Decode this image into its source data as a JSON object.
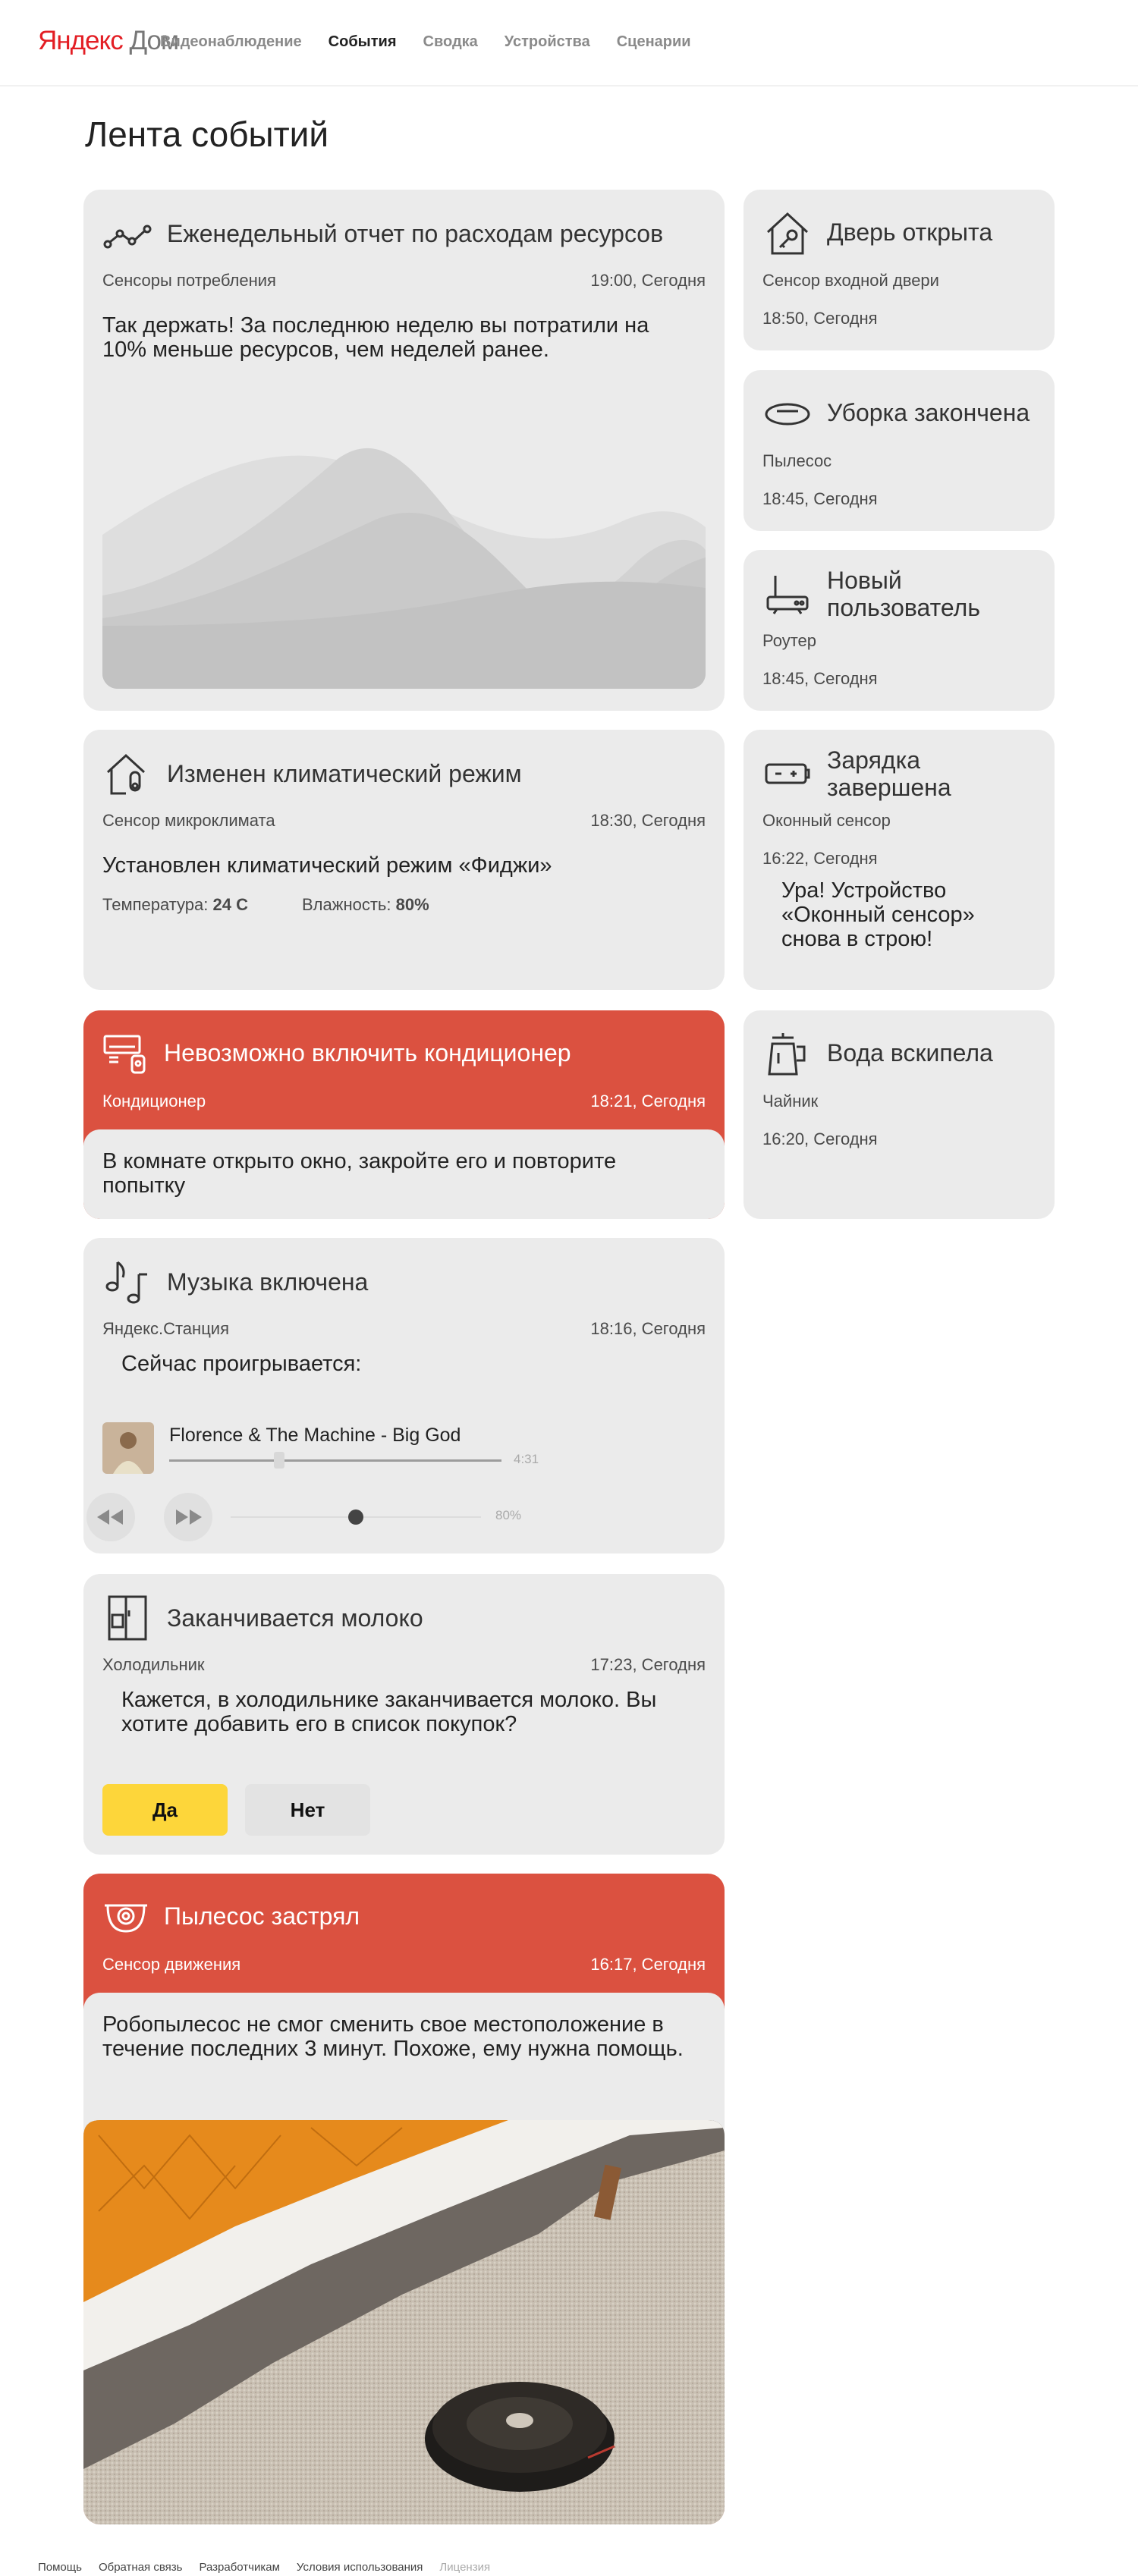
{
  "header": {
    "logo_part1": "Яндекс",
    "logo_part2": "Дом",
    "nav": [
      {
        "label": "Видеонаблюдение",
        "active": false
      },
      {
        "label": "События",
        "active": true
      },
      {
        "label": "Сводка",
        "active": false
      },
      {
        "label": "Устройства",
        "active": false
      },
      {
        "label": "Сценарии",
        "active": false
      }
    ]
  },
  "page_title": "Лента событий",
  "cards": {
    "report": {
      "title": "Еженедельный отчет по расходам ресурсов",
      "source": "Сенсоры потребления",
      "time": "19:00, Сегодня",
      "text": "Так держать! За последнюю неделю вы потратили на 10% меньше ресурсов, чем неделей ранее.",
      "icon": "graph-icon"
    },
    "door": {
      "title": "Дверь открыта",
      "source": "Сенсор входной двери",
      "time": "18:50, Сегодня",
      "icon": "house-key-icon"
    },
    "cleaning": {
      "title": "Уборка закончена",
      "source": "Пылесос",
      "time": "18:45, Сегодня",
      "icon": "vacuum-icon"
    },
    "newuser": {
      "title_line1": "Новый",
      "title_line2": "пользователь",
      "source": "Роутер",
      "time": "18:45, Сегодня",
      "icon": "router-icon"
    },
    "climate": {
      "title": "Изменен климатический режим",
      "source": "Сенсор микроклимата",
      "time": "18:30, Сегодня",
      "text": "Установлен климатический режим «Фиджи»",
      "temp_label": "Температура:",
      "temp_value": "24 С",
      "humidity_label": "Влажность:",
      "humidity_value": "80%",
      "icon": "climate-house-icon"
    },
    "charge": {
      "title_line1": "Зарядка",
      "title_line2": "завершена",
      "source": "Оконный сенсор",
      "time": "16:22, Сегодня",
      "text_line1": "Ура! Устройство",
      "text_line2": "«Оконный сенсор»",
      "text_line3": "снова в строю!",
      "icon": "battery-icon"
    },
    "ac": {
      "title": "Невозможно включить кондиционер",
      "source": "Кондиционер",
      "time": "18:21, Сегодня",
      "text_line1": "В комнате открыто окно, закройте его и повторите",
      "text_line2": "попытку",
      "icon": "air-conditioner-icon",
      "color": "#db5140"
    },
    "kettle": {
      "title": "Вода вскипела",
      "source": "Чайник",
      "time": "16:20, Сегодня",
      "icon": "kettle-icon"
    },
    "music": {
      "title": "Музыка включена",
      "source": "Яндекс.Станция",
      "time": "18:16, Сегодня",
      "now_playing": "Сейчас проигрывается:",
      "track": "Florence & The Machine - Big God",
      "duration": "4:31",
      "progress": 0.33,
      "volume": "80%",
      "volume_level": 0.5,
      "icon": "music-note-icon"
    },
    "milk": {
      "title": "Заканчивается молоко",
      "source": "Холодильник",
      "time": "17:23, Сегодня",
      "text_line1": "Кажется, в холодильнике заканчивается молоко. Вы",
      "text_line2": "хотите добавить его в список покупок?",
      "yes": "Да",
      "no": "Нет",
      "icon": "fridge-icon"
    },
    "vacuum": {
      "title": "Пылесос застрял",
      "source": "Сенсор движения",
      "time": "16:17, Сегодня",
      "text_line1": "Робопылесос не смог сменить свое местоположение в",
      "text_line2": "течение последних 3 минут. Похоже, ему нужна помощь.",
      "icon": "camera-icon",
      "color": "#db5140"
    }
  },
  "footer": {
    "links": [
      "Помощь",
      "Обратная связь",
      "Разработчикам",
      "Условия использования"
    ],
    "license": "Лицензия"
  },
  "colors": {
    "accent_yellow": "#fdd63a",
    "alert_red": "#db5140",
    "card_bg": "#ebebeb",
    "logo_red": "#e31e24"
  }
}
